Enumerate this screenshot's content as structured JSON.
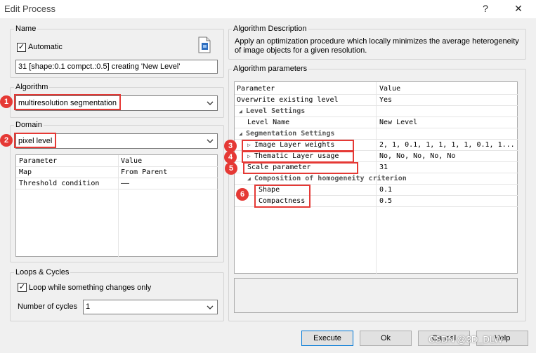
{
  "window": {
    "title": "Edit Process",
    "help_label": "?",
    "close_label": "✕"
  },
  "name": {
    "group_label": "Name",
    "automatic_label": "Automatic",
    "automatic_checked": "✓",
    "process_text": "31 [shape:0.1 compct.:0.5] creating 'New Level'"
  },
  "algorithm": {
    "group_label": "Algorithm",
    "selected": "multiresolution segmentation",
    "badge": "1"
  },
  "domain": {
    "group_label": "Domain",
    "selected": "pixel level",
    "badge": "2",
    "header": {
      "param": "Parameter",
      "value": "Value"
    },
    "rows": [
      {
        "param": "Map",
        "value": "From Parent"
      },
      {
        "param": "Threshold condition",
        "value": "——"
      }
    ]
  },
  "loops": {
    "group_label": "Loops & Cycles",
    "loop_label": "Loop while something changes only",
    "loop_checked": "✓",
    "cycles_label": "Number of cycles",
    "cycles_value": "1"
  },
  "description": {
    "group_label": "Algorithm Description",
    "text": "Apply an optimization procedure which locally minimizes the average heterogeneity of image objects for a given resolution."
  },
  "params": {
    "group_label": "Algorithm parameters",
    "header": {
      "param": "Parameter",
      "value": "Value"
    },
    "overwrite": {
      "param": "Overwrite existing level",
      "value": "Yes"
    },
    "level_settings": "Level Settings",
    "level_name": {
      "param": "Level Name",
      "value": "New Level"
    },
    "seg_settings": "Segmentation Settings",
    "image_layer": {
      "param": "Image Layer weights",
      "value": "2, 1, 0.1, 1, 1, 1, 1, 0.1, 1..."
    },
    "thematic_layer": {
      "param": "Thematic Layer usage",
      "value": "No, No, No, No, No"
    },
    "scale": {
      "param": "Scale parameter",
      "value": "31"
    },
    "composition": "Composition of homogeneity criterion",
    "shape": {
      "param": "Shape",
      "value": "0.1"
    },
    "compactness": {
      "param": "Compactness",
      "value": "0.5"
    },
    "badges": {
      "b3": "3",
      "b4": "4",
      "b5": "5",
      "b6": "6"
    }
  },
  "buttons": {
    "execute": "Execute",
    "ok": "Ok",
    "cancel": "Cancel",
    "help": "Help"
  },
  "watermark": "CSDN @3D_DLW"
}
